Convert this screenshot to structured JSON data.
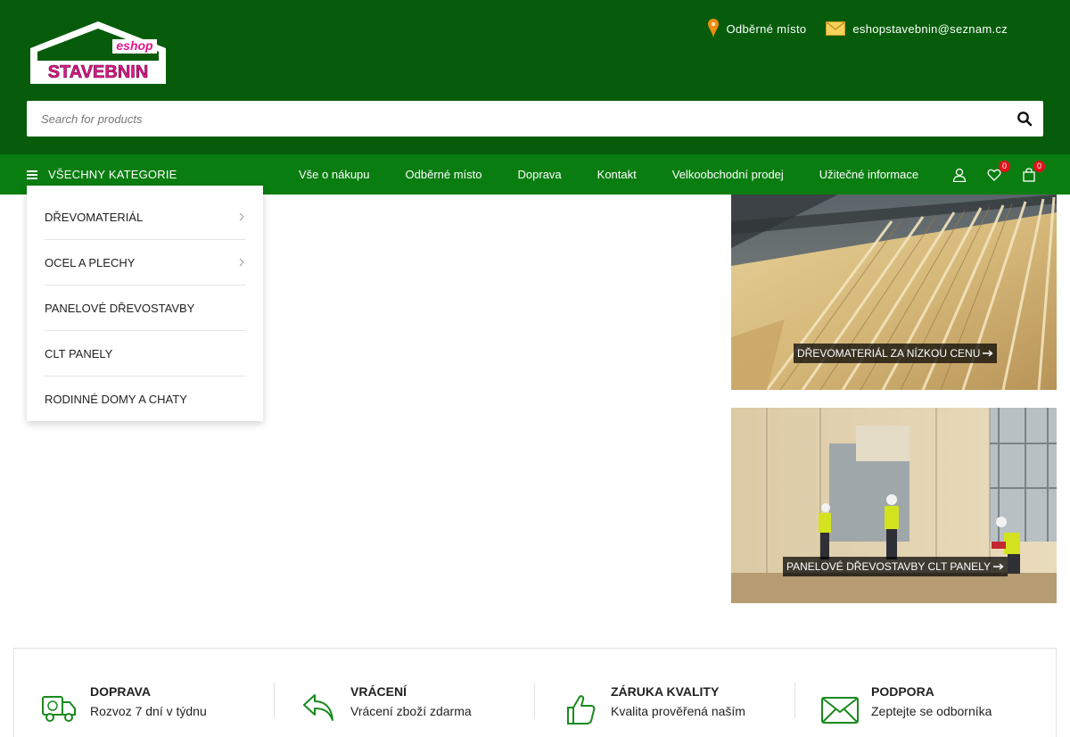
{
  "header": {
    "logo_small": "eshop",
    "logo_big": "STAVEBNIN",
    "pickup_label": "Odběrné místo",
    "email": "eshopstavebnin@seznam.cz"
  },
  "search": {
    "placeholder": "Search for products"
  },
  "nav": {
    "all_categories": "VŠECHNY KATEGORIE",
    "links": [
      "Vše o nákupu",
      "Odběrné místo",
      "Doprava",
      "Kontakt",
      "Velkoobchodní prodej",
      "Užitečné informace"
    ],
    "wishlist_count": "0",
    "cart_count": "0"
  },
  "categories": [
    {
      "label": "DŘEVOMATERIÁL",
      "has_sub": true
    },
    {
      "label": "OCEL A PLECHY",
      "has_sub": true
    },
    {
      "label": "PANELOVÉ DŘEVOSTAVBY",
      "has_sub": false
    },
    {
      "label": "CLT PANELY",
      "has_sub": false
    },
    {
      "label": "RODINNÉ DOMY A CHATY",
      "has_sub": false
    }
  ],
  "banners": [
    {
      "label": "DŘEVOMATERIÁL ZA NÍZKOU CENU"
    },
    {
      "label": "PANELOVÉ DŘEVOSTAVBY CLT PANELY"
    }
  ],
  "features": [
    {
      "title": "DOPRAVA",
      "text": "Rozvoz 7 dní v týdnu",
      "icon": "truck-icon"
    },
    {
      "title": "VRÁCENÍ",
      "text": "Vrácení zboží zdarma",
      "icon": "return-arrow-icon"
    },
    {
      "title": "ZÁRUKA KVALITY",
      "text": "Kvalita prověřená naším",
      "icon": "thumbs-up-icon"
    },
    {
      "title": "PODPORA",
      "text": "Zeptejte se odborníka",
      "icon": "envelope-icon"
    }
  ],
  "colors": {
    "header_bg": "#065c0a",
    "nav_bg": "#0a7d11",
    "badge": "#e1121b",
    "logo_pink": "#e3168a"
  }
}
